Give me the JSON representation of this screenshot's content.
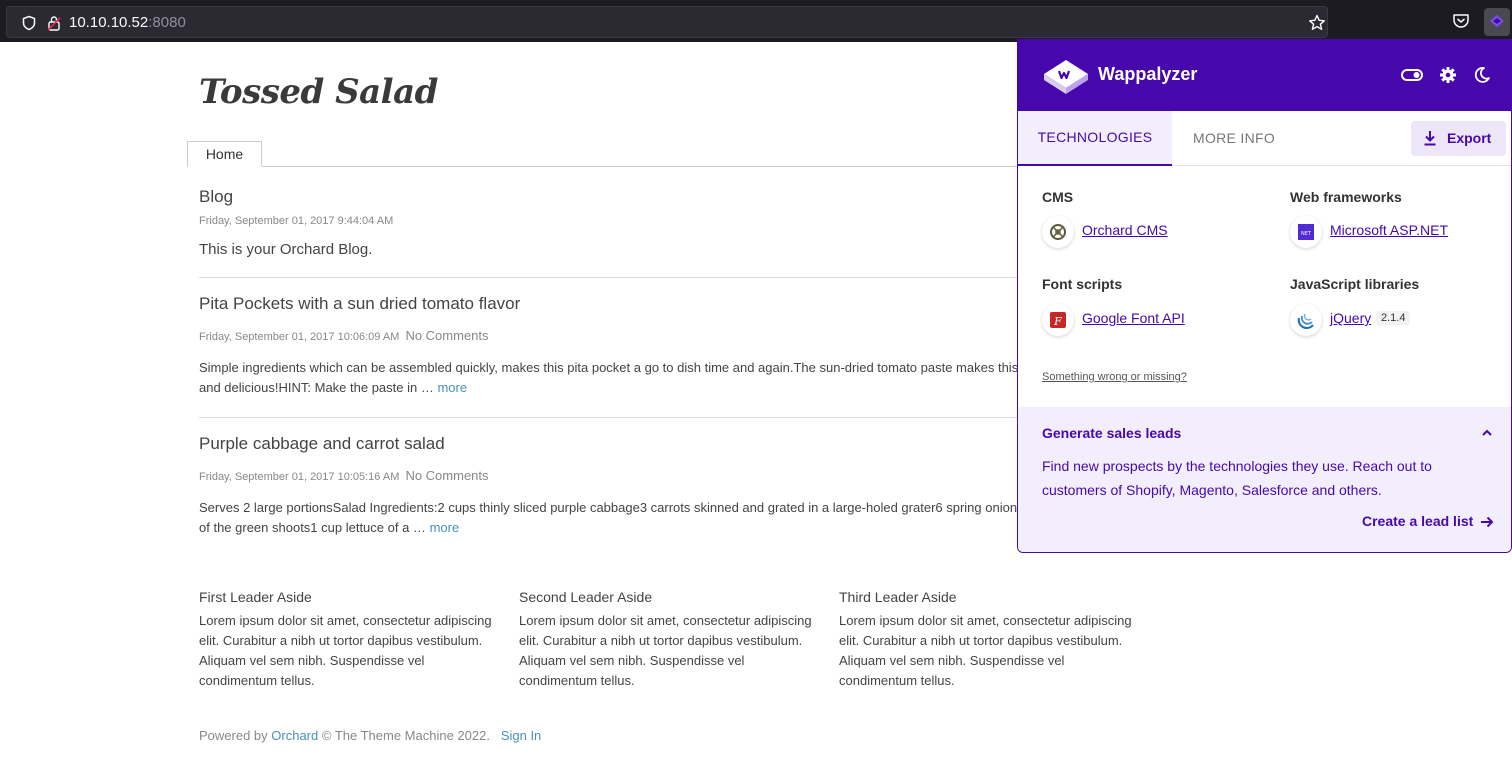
{
  "browser": {
    "url_host": "10.10.10.52",
    "url_port": ":8080"
  },
  "site": {
    "title": "Tossed Salad",
    "nav": [
      "Home"
    ],
    "blog_title": "Blog",
    "blog_date": "Friday, September 01, 2017 9:44:04 AM",
    "blog_desc": "This is your Orchard Blog.",
    "posts": [
      {
        "title": "Pita Pockets with a sun dried tomato flavor",
        "date": "Friday, September 01, 2017 10:06:09 AM",
        "comments": "No Comments",
        "line1": "Simple ingredients which can be assembled quickly, makes this pita pocket a go to dish time and again.The sun-dried tomato paste makes this",
        "line2": "and delicious!HINT:  Make the paste in …",
        "more": "more"
      },
      {
        "title": "Purple cabbage and carrot salad",
        "date": "Friday, September 01, 2017 10:05:16 AM",
        "comments": "No Comments",
        "line1": "Serves 2 large portionsSalad Ingredients:2 cups thinly sliced purple cabbage3 carrots skinned and grated in a large-holed grater6 spring onion",
        "line2": "of the green shoots1 cup lettuce of a …",
        "more": "more"
      }
    ],
    "asides": [
      {
        "title": "First Leader Aside",
        "body": "Lorem ipsum dolor sit amet, consectetur adipiscing elit. Curabitur a nibh ut tortor dapibus vestibulum. Aliquam vel sem nibh. Suspendisse vel condimentum tellus."
      },
      {
        "title": "Second Leader Aside",
        "body": "Lorem ipsum dolor sit amet, consectetur adipiscing elit. Curabitur a nibh ut tortor dapibus vestibulum. Aliquam vel sem nibh. Suspendisse vel condimentum tellus."
      },
      {
        "title": "Third Leader Aside",
        "body": "Lorem ipsum dolor sit amet, consectetur adipiscing elit. Curabitur a nibh ut tortor dapibus vestibulum. Aliquam vel sem nibh. Suspendisse vel condimentum tellus."
      }
    ],
    "footer": {
      "powered": "Powered by",
      "orchard": "Orchard",
      "copyright": "© The Theme Machine 2022.",
      "sign_in": "Sign In"
    }
  },
  "wappalyzer": {
    "brand": "Wappalyzer",
    "tabs": {
      "technologies": "TECHNOLOGIES",
      "more_info": "MORE INFO"
    },
    "export_label": "Export",
    "categories": [
      {
        "name": "CMS",
        "tech": "Orchard CMS",
        "version": ""
      },
      {
        "name": "Web frameworks",
        "tech": "Microsoft ASP.NET",
        "version": ""
      },
      {
        "name": "Font scripts",
        "tech": "Google Font API",
        "version": ""
      },
      {
        "name": "JavaScript libraries",
        "tech": "jQuery",
        "version": "2.1.4"
      }
    ],
    "wrong_link": "Something wrong or missing?",
    "leads": {
      "title": "Generate sales leads",
      "body": "Find new prospects by the technologies they use. Reach out to customers of Shopify, Magento, Salesforce and others.",
      "link": "Create a lead list"
    },
    "accent_color": "#4608ad"
  }
}
